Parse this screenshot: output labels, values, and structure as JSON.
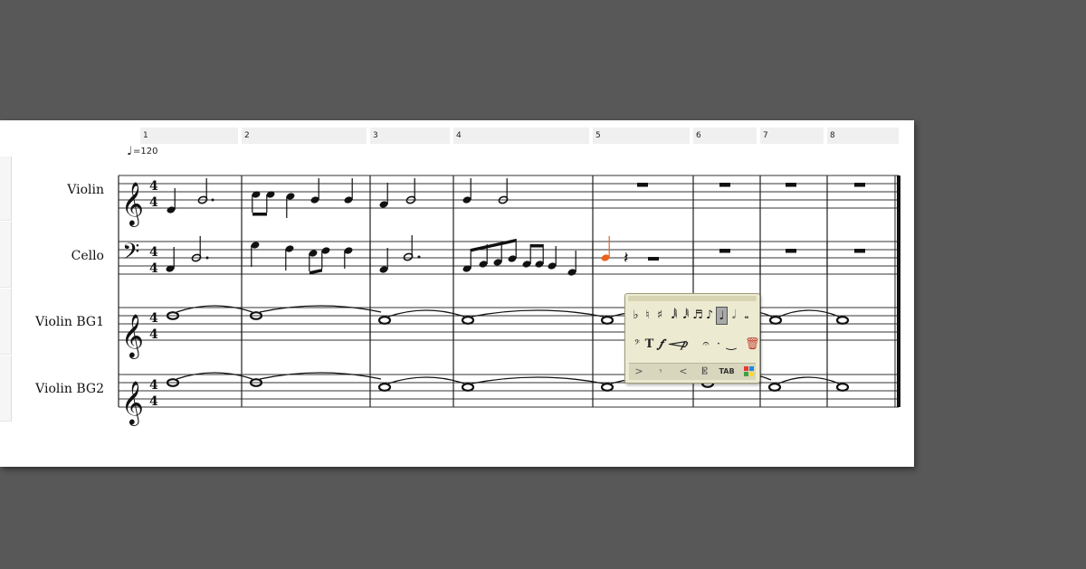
{
  "score": {
    "tempo": {
      "icon": "quarter-note-icon",
      "text": "=120"
    },
    "measure_numbers": [
      "1",
      "2",
      "3",
      "4",
      "5",
      "6",
      "7",
      "8"
    ],
    "instruments": [
      {
        "name": "Violin",
        "clef": "treble"
      },
      {
        "name": "Cello",
        "clef": "bass"
      },
      {
        "name": "Violin BG1",
        "clef": "treble"
      },
      {
        "name": "Violin BG2",
        "clef": "treble"
      }
    ],
    "time_signature": {
      "top": "4",
      "bottom": "4"
    },
    "highlight_color": "#e8641e"
  },
  "palette": {
    "accidentals": [
      "♭",
      "♮",
      "♯"
    ],
    "durations_icons": [
      "sixty-fourth-note-icon",
      "thirty-second-note-icon",
      "sixteenth-note-icon",
      "eighth-note-icon",
      "quarter-note-icon",
      "half-note-icon",
      "whole-note-icon"
    ],
    "text_tools": [
      "T",
      "𝆑",
      "𝆒",
      "𝆏"
    ],
    "articulation_icons": [
      "fermata-icon",
      "dot-icon",
      "tie-icon"
    ],
    "bottom_icons": [
      "accent-icon",
      "staccato-icon",
      "hairpin-icon",
      "flat-clef-icon"
    ],
    "tab_label": "TAB",
    "colors": [
      "#e53935",
      "#1e88e5",
      "#43a047",
      "#fdd835"
    ]
  }
}
